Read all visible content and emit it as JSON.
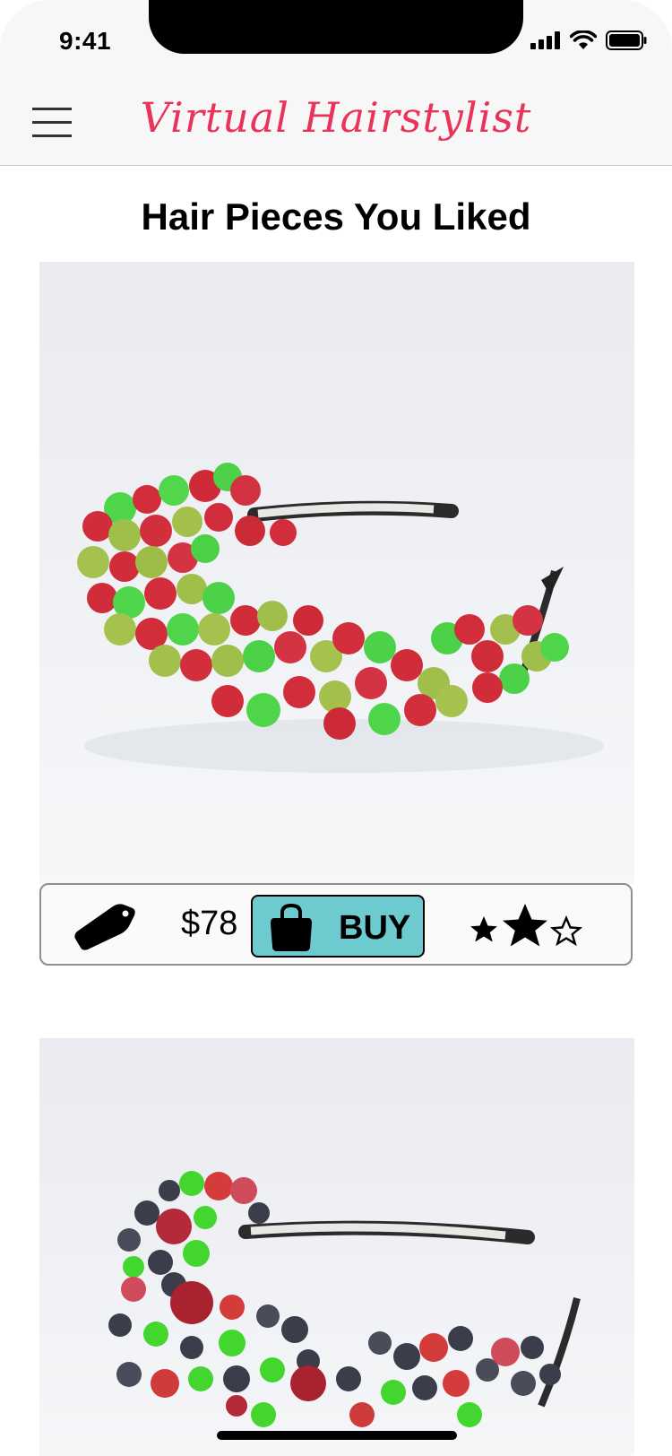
{
  "status_bar": {
    "time": "9:41"
  },
  "header": {
    "brand": "Virtual Hairstylist"
  },
  "page": {
    "title": "Hair Pieces You Liked"
  },
  "items": [
    {
      "image": "red-green-berry-headband",
      "price": "$78",
      "buy_label": "BUY",
      "rating": {
        "filled": 2,
        "total": 3
      }
    },
    {
      "image": "dark-berry-rose-headband"
    }
  ],
  "colors": {
    "brand": "#e8345a",
    "buy_button": "#6dcace",
    "background": "#ffffff",
    "header_bg": "#f7f7f8"
  }
}
